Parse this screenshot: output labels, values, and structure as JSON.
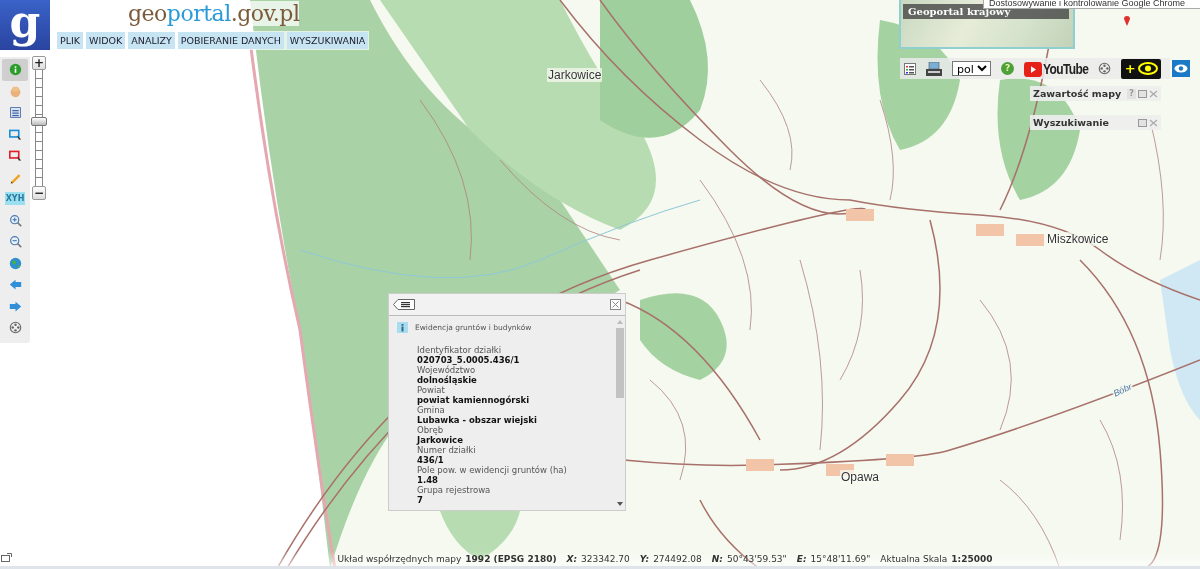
{
  "browser_tooltip": "Dostosowywanie i kontrolowanie Google Chrome",
  "logo": {
    "letter": "g",
    "site_name_parts": [
      "geo",
      "portal",
      ".gov.pl"
    ]
  },
  "menu": [
    {
      "label": "PLIK"
    },
    {
      "label": "WIDOK"
    },
    {
      "label": "ANALIZY"
    },
    {
      "label": "POBIERANIE DANYCH"
    },
    {
      "label": "WYSZUKIWANIA"
    }
  ],
  "tools": [
    {
      "kind": "info",
      "selected": true
    },
    {
      "kind": "pan",
      "selected": false
    },
    {
      "kind": "legend",
      "selected": false
    },
    {
      "kind": "select-blue",
      "selected": false
    },
    {
      "kind": "select-red",
      "selected": false
    },
    {
      "kind": "pencil",
      "selected": false
    },
    {
      "kind": "xyh",
      "label": "XYH",
      "selected": false
    },
    {
      "kind": "zoom-in",
      "selected": false
    },
    {
      "kind": "zoom-out",
      "selected": false
    },
    {
      "kind": "globe",
      "selected": false
    },
    {
      "kind": "back",
      "selected": false
    },
    {
      "kind": "forward",
      "selected": false
    },
    {
      "kind": "reel",
      "selected": false
    }
  ],
  "zoom_slider": {
    "plus": "+",
    "minus": "−",
    "level": 0.55
  },
  "overview_map": {
    "title": "Geoportal krajowy"
  },
  "toolbar": {
    "language": "pol",
    "help": "?",
    "video_label": "YouTube",
    "contrast_symbol": "+"
  },
  "panels": [
    {
      "title": "Zawartość mapy",
      "help": "?"
    },
    {
      "title": "Wyszukiwanie"
    }
  ],
  "map_labels": [
    {
      "text": "Jarkowice"
    },
    {
      "text": "Miszkowice"
    },
    {
      "text": "Opawa"
    },
    {
      "text": "Bóbr"
    }
  ],
  "info_popup": {
    "source": "Ewidencja gruntów i budynków",
    "fields": [
      {
        "label": "Identyfikator działki",
        "value": "020703_5.0005.436/1"
      },
      {
        "label": "Województwo",
        "value": "dolnośląskie"
      },
      {
        "label": "Powiat",
        "value": "powiat kamiennogórski"
      },
      {
        "label": "Gmina",
        "value": "Lubawka - obszar wiejski"
      },
      {
        "label": "Obręb",
        "value": "Jarkowice"
      },
      {
        "label": "Numer działki",
        "value": "436/1"
      },
      {
        "label": "Pole pow. w ewidencji gruntów (ha)",
        "value": "1.48"
      },
      {
        "label": "Grupa rejestrowa",
        "value": "7"
      }
    ]
  },
  "status_bar": {
    "crs_label": "Układ współrzędnych mapy",
    "crs_value": "1992 (EPSG 2180)",
    "x_label": "X:",
    "x_value": "323342.70",
    "y_label": "Y:",
    "y_value": "274492.08",
    "n_label": "N:",
    "n_value": "50°43'59.53\"",
    "e_label": "E:",
    "e_value": "15°48'11.69\"",
    "scale_label": "Aktualna Skala",
    "scale_value": "1:25000"
  }
}
